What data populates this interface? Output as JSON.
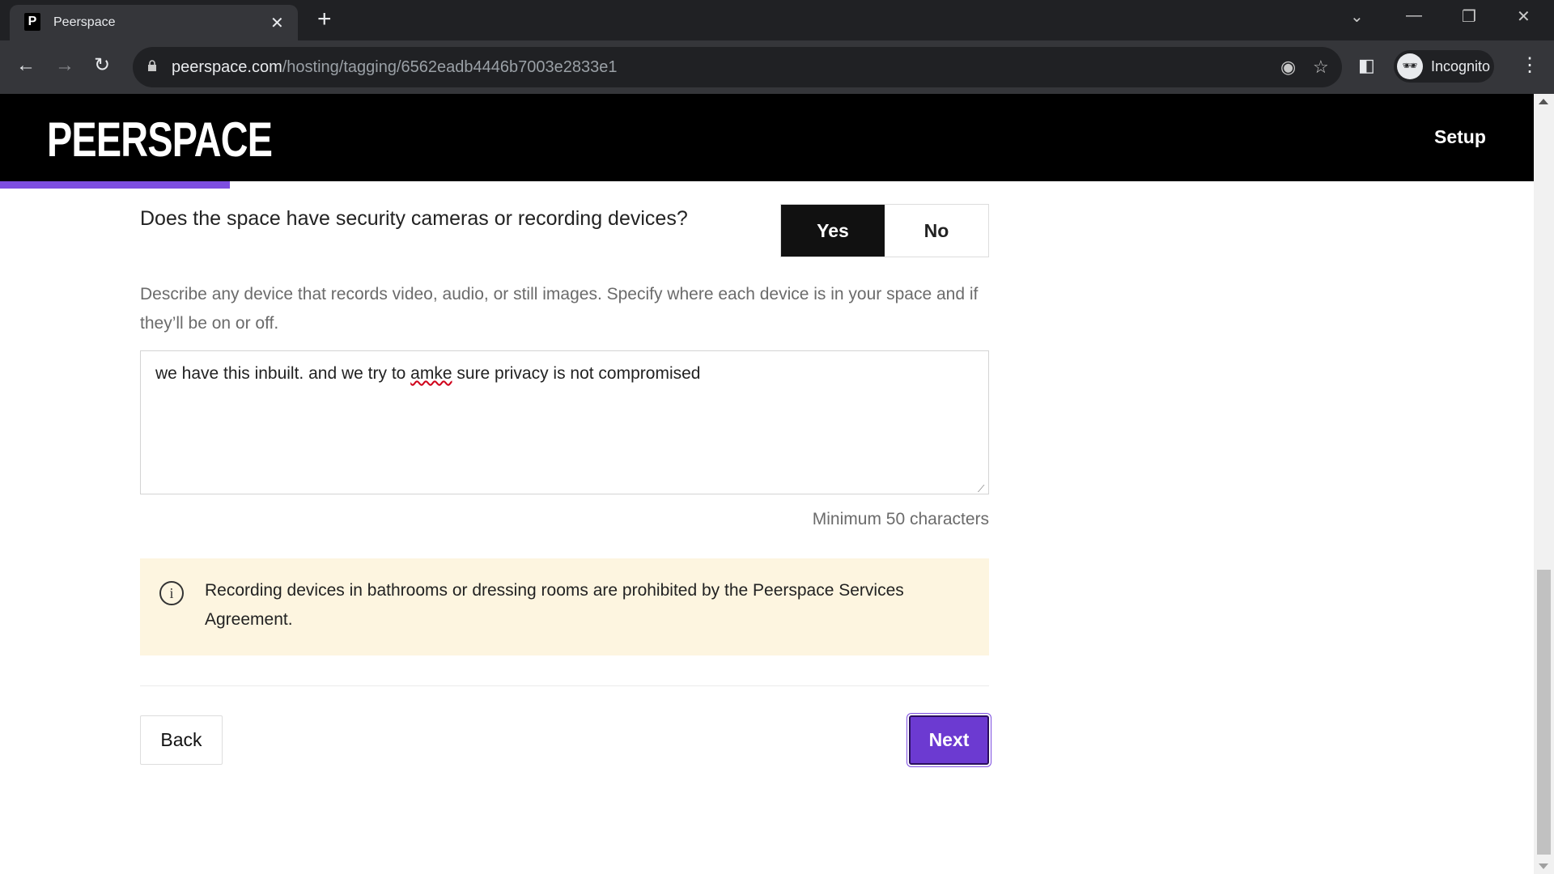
{
  "browser": {
    "tab_title": "Peerspace",
    "tab_favicon": "P",
    "url_host": "peerspace.com",
    "url_path": "/hosting/tagging/6562eadb4446b7003e2833e1",
    "profile_label": "Incognito"
  },
  "header": {
    "logo": "PEERSPACE",
    "setup_label": "Setup",
    "progress_percent": 15
  },
  "form": {
    "question": "Does the space have security cameras or recording devices?",
    "toggle": {
      "yes_label": "Yes",
      "no_label": "No",
      "selected": "Yes"
    },
    "description": "Describe any device that records video, audio, or still images. Specify where each device is in your space and if they’ll be on or off.",
    "textarea_value_before": "we have this inbuilt. and we try to ",
    "textarea_misspelled": "amke",
    "textarea_value_after": " sure privacy is not compromised",
    "min_chars_hint": "Minimum 50 characters",
    "notice_text": "Recording devices in bathrooms or dressing rooms are prohibited by the Peerspace Services Agreement."
  },
  "footer": {
    "back_label": "Back",
    "next_label": "Next"
  },
  "colors": {
    "accent": "#7d4ee0",
    "next_button": "#6c3ad1",
    "notice_bg": "#fdf5e0",
    "header_bg": "#000000"
  }
}
